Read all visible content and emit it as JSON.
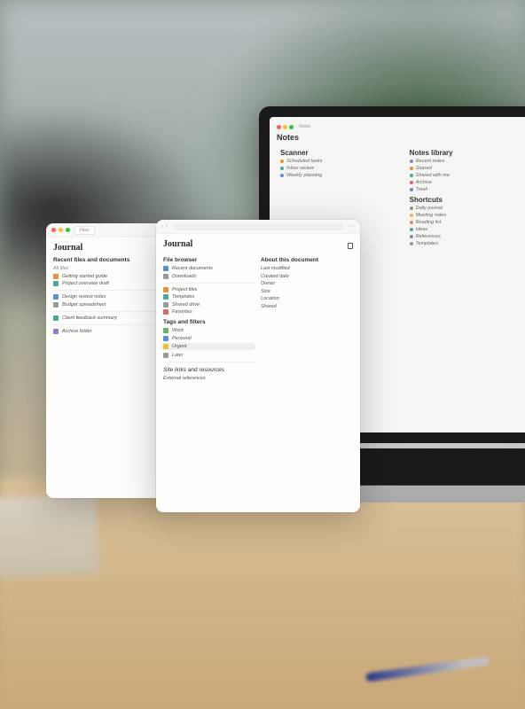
{
  "laptop": {
    "toolbar": {
      "tab": "Notes"
    },
    "header": "Notes",
    "col_left": {
      "heading": "Scanner",
      "items": [
        {
          "color": "#e89040",
          "label": "Scheduled tasks"
        },
        {
          "color": "#4aa89a",
          "label": "Inbox review"
        },
        {
          "color": "#5a8fd6",
          "label": "Weekly planning"
        }
      ]
    },
    "col_right": {
      "heading1": "Notes library",
      "items1": [
        {
          "color": "#9a7ac6",
          "label": "Recent notes"
        },
        {
          "color": "#e89040",
          "label": "Starred"
        },
        {
          "color": "#4aa89a",
          "label": "Shared with me"
        },
        {
          "color": "#d86a6a",
          "label": "Archive"
        },
        {
          "color": "#5a8fd6",
          "label": "Trash"
        }
      ],
      "heading2": "Shortcuts",
      "items2": [
        {
          "color": "#6ab06a",
          "label": "Daily journal"
        },
        {
          "color": "#e8c040",
          "label": "Meeting notes"
        },
        {
          "color": "#e89040",
          "label": "Reading list"
        },
        {
          "color": "#4aa89a",
          "label": "Ideas"
        },
        {
          "color": "#9a7ac6",
          "label": "References"
        },
        {
          "color": "#999999",
          "label": "Templates"
        }
      ]
    }
  },
  "window_left": {
    "tab": "Files",
    "title": "Journal",
    "section1": {
      "heading": "Recent files and documents",
      "sub": "All files",
      "items": [
        {
          "color": "#e89040",
          "label": "Getting started guide"
        },
        {
          "color": "#4aa89a",
          "label": "Project overview draft"
        }
      ]
    },
    "section2": {
      "items": [
        {
          "color": "#5a8fd6",
          "label": "Design review notes"
        },
        {
          "color": "#999999",
          "label": "Budget spreadsheet"
        }
      ]
    },
    "section3": {
      "items": [
        {
          "color": "#4aa89a",
          "label": "Client feedback summary"
        }
      ]
    },
    "section4": {
      "items": [
        {
          "color": "#9a7ac6",
          "label": "Archive folder"
        }
      ]
    }
  },
  "window_right": {
    "title": "Journal",
    "left_col": {
      "heading": "File browser",
      "groups": [
        {
          "items": [
            {
              "color": "#5a8fd6",
              "label": "Recent documents"
            },
            {
              "color": "#999999",
              "label": "Downloads"
            }
          ]
        },
        {
          "items": [
            {
              "color": "#e89040",
              "label": "Project files"
            },
            {
              "color": "#4aa89a",
              "label": "Templates"
            },
            {
              "color": "#999999",
              "label": "Shared drive"
            },
            {
              "color": "#d86a6a",
              "label": "Favorites"
            }
          ]
        },
        {
          "heading": "Tags and filters",
          "items": [
            {
              "color": "#6ab06a",
              "label": "Work"
            },
            {
              "color": "#5a8fd6",
              "label": "Personal"
            },
            {
              "color": "#e8c040",
              "label": "Urgent",
              "selected": true
            },
            {
              "color": "#999999",
              "label": "Later"
            }
          ]
        },
        {
          "heading": "Site links and resources",
          "items": [
            {
              "label": "External references"
            }
          ]
        }
      ]
    },
    "right_col": {
      "heading": "About this document",
      "items": [
        {
          "label": "Last modified"
        },
        {
          "label": "Created date"
        },
        {
          "label": "Owner"
        },
        {
          "label": "Size"
        },
        {
          "label": "Location"
        },
        {
          "label": "Shared"
        }
      ]
    }
  }
}
